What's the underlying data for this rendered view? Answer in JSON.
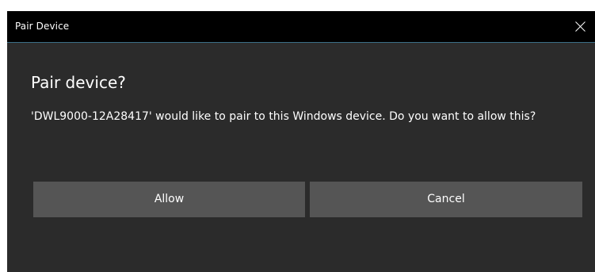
{
  "window": {
    "title": "Pair Device",
    "close_icon": "close-icon"
  },
  "dialog": {
    "heading": "Pair device?",
    "message": "'DWL9000-12A28417' would like to pair to this Windows device. Do you want to allow this?",
    "allow_label": "Allow",
    "cancel_label": "Cancel"
  },
  "colors": {
    "titlebar": "#000000",
    "background": "#2b2b2b",
    "button": "#555555",
    "text": "#ffffff",
    "titlebar_border": "#3c6e86"
  }
}
